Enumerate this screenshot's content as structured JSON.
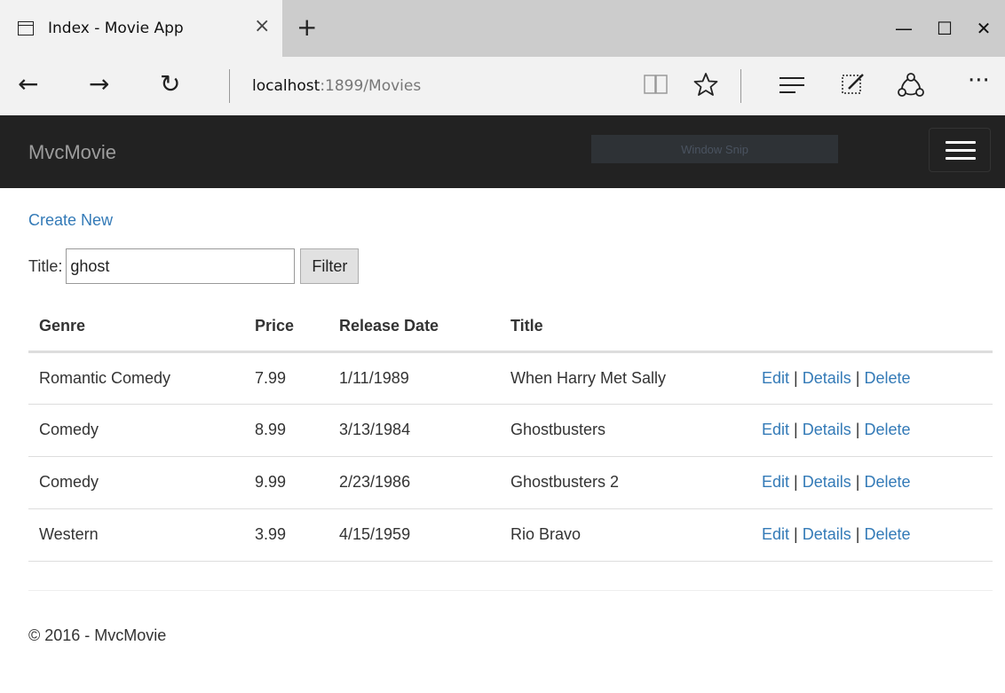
{
  "browser": {
    "tab_title": "Index - Movie App",
    "tab_close": "×",
    "new_tab": "+",
    "minimize": "—",
    "maximize": "☐",
    "close": "✕",
    "back": "←",
    "forward": "→",
    "refresh": "↻",
    "url_host": "localhost",
    "url_path": ":1899/Movies",
    "icons": [
      "reading-view-icon",
      "favorite-icon",
      "hub-icon",
      "web-note-icon",
      "share-icon",
      "more-icon"
    ]
  },
  "navbar": {
    "brand": "MvcMovie",
    "overlay": "Window Snip",
    "colors": {
      "background": "#222222",
      "brand": "#9d9d9d"
    }
  },
  "page": {
    "create_new": "Create New",
    "filter": {
      "label": "Title:",
      "value": "ghost",
      "button": "Filter"
    },
    "table": {
      "headers": [
        "Genre",
        "Price",
        "Release Date",
        "Title"
      ],
      "rows": [
        {
          "genre": "Romantic Comedy",
          "price": "7.99",
          "release_date": "1/11/1989",
          "title": "When Harry Met Sally"
        },
        {
          "genre": "Comedy",
          "price": "8.99",
          "release_date": "3/13/1984",
          "title": "Ghostbusters"
        },
        {
          "genre": "Comedy",
          "price": "9.99",
          "release_date": "2/23/1986",
          "title": "Ghostbusters 2"
        },
        {
          "genre": "Western",
          "price": "3.99",
          "release_date": "4/15/1959",
          "title": "Rio Bravo"
        }
      ],
      "actions": {
        "edit": "Edit",
        "details": "Details",
        "delete": "Delete",
        "separator": "|"
      }
    },
    "footer": "© 2016 - MvcMovie",
    "colors": {
      "link": "#337ab7",
      "text": "#333333"
    }
  }
}
